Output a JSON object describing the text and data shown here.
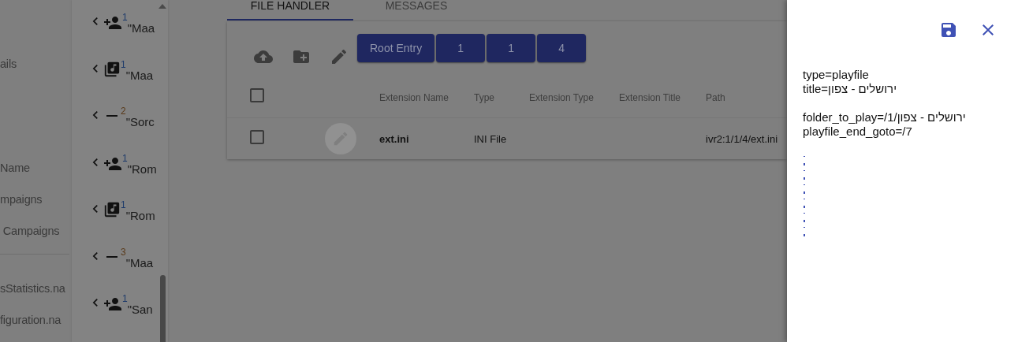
{
  "sidebar": {
    "sections": [
      {
        "divider": false,
        "items": [
          "ails"
        ]
      },
      {
        "divider": false,
        "items": [
          "Name",
          "mpaigns",
          " Campaigns"
        ]
      },
      {
        "divider": true,
        "items": [
          "sStatistics.na",
          "figuration.na"
        ]
      }
    ]
  },
  "tree": {
    "items": [
      {
        "kind": "person-add",
        "count": "1",
        "label": "\"Maa"
      },
      {
        "kind": "music",
        "count": "1",
        "label": "\"Maa"
      },
      {
        "kind": "minus",
        "count": "2",
        "label": "\"Sorc"
      },
      {
        "kind": "person-add",
        "count": "1",
        "label": "\"Rom"
      },
      {
        "kind": "music",
        "count": "1",
        "label": "\"Rom"
      },
      {
        "kind": "minus",
        "count": "3",
        "label": "\"Maa"
      },
      {
        "kind": "person-add",
        "count": "1",
        "label": "\"San"
      }
    ]
  },
  "tabs": [
    {
      "label": "FILE HANDLER",
      "selected": true
    },
    {
      "label": "MESSAGES",
      "selected": false
    }
  ],
  "toolbar": {
    "breadcrumbs": [
      "Root Entry",
      "1",
      "1",
      "4"
    ]
  },
  "table": {
    "columns": [
      "Extension Name",
      "Type",
      "Extension Type",
      "Extension Title",
      "Path"
    ],
    "header_checked": false,
    "rows": [
      {
        "checked": false,
        "cells": [
          "ext.ini",
          "INI File",
          "",
          "",
          "ivr2:1/1/4/ext.ini"
        ]
      }
    ]
  },
  "drawer": {
    "paragraphs": [
      [
        "type=playfile",
        "title=ירושלים - צפון"
      ],
      [
        "folder_to_play=/1/ירושלים - צפון",
        "playfile_end_goto=/7"
      ]
    ]
  }
}
